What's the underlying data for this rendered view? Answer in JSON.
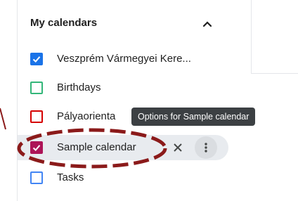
{
  "sidebar": {
    "section_title": "My calendars",
    "collapse_icon": "chevron-up-icon",
    "calendars": [
      {
        "label": "Veszprém Vármegyei Kere...",
        "color": "#1a73e8",
        "checked": true
      },
      {
        "label": "Birthdays",
        "color": "#33b679",
        "checked": false
      },
      {
        "label": "Pályaorienta",
        "color": "#d50000",
        "checked": false
      },
      {
        "label": "Sample calendar",
        "color": "#ad1457",
        "checked": true
      },
      {
        "label": "Tasks",
        "color": "#4285f4",
        "checked": false
      }
    ],
    "hovered_item": {
      "close_icon": "close-icon",
      "options_icon": "more-vert-icon"
    }
  },
  "tooltip": {
    "text": "Options for Sample calendar"
  },
  "annotation": {
    "color": "#8b1a1a"
  }
}
